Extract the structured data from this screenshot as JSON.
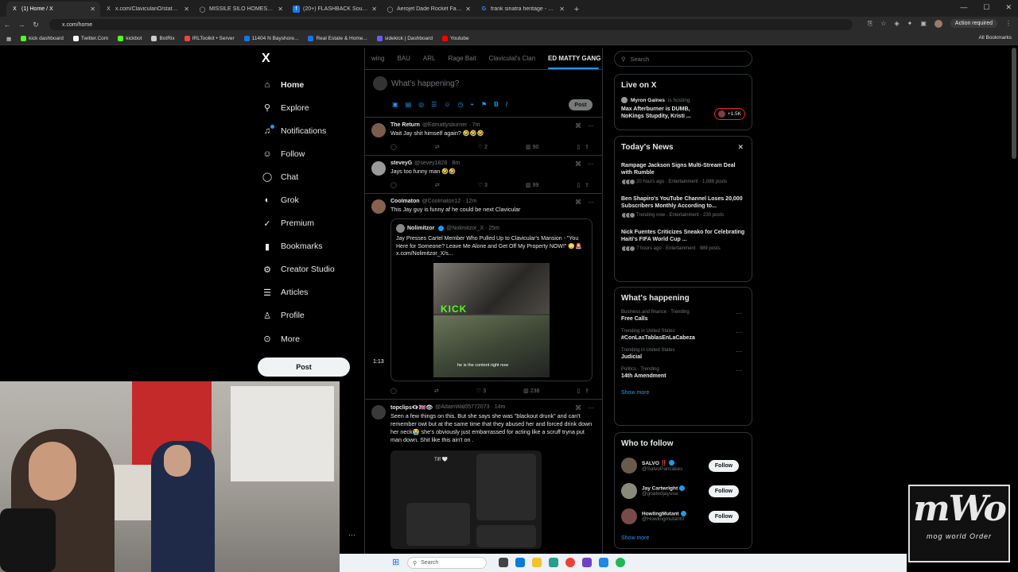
{
  "browser": {
    "tabs": [
      {
        "title": "(1) Home / X",
        "color": "#ffffff",
        "glyph": "X"
      },
      {
        "title": "x.com/ClaviculanO/status/2039...",
        "color": "#ffffff",
        "glyph": "X"
      },
      {
        "title": "MISSILE SILO HOMESTEAD - G...",
        "color": "#aaaaaa",
        "glyph": "◯"
      },
      {
        "title": "(20+) FLASHBACK South Florid...",
        "color": "#1877f2",
        "glyph": "f"
      },
      {
        "title": "Aerojet Dade Rocket Facility | ...",
        "color": "#aaaaaa",
        "glyph": "◯"
      },
      {
        "title": "frank sinatra heritage - Google...",
        "color": "#4285f4",
        "glyph": "G"
      }
    ],
    "new_tab": "+",
    "url": "x.com/home",
    "action_required": "Action required",
    "bookmarks": [
      {
        "label": "kick dashboard",
        "color": "#53fc18"
      },
      {
        "label": "Twitter.Com",
        "color": "#ffffff"
      },
      {
        "label": "kickbot",
        "color": "#53fc18"
      },
      {
        "label": "BotRix",
        "color": "#cccccc"
      },
      {
        "label": "IRLToolkit • Server",
        "color": "#e44"
      },
      {
        "label": "11404 N Bayshore...",
        "color": "#1a73e8"
      },
      {
        "label": "Real Estate & Home...",
        "color": "#1a73e8"
      },
      {
        "label": "sidekick | Dashboard",
        "color": "#6b5bff"
      },
      {
        "label": "Youtube",
        "color": "#ff0000"
      }
    ],
    "all_bookmarks": "All Bookmarks"
  },
  "nav": {
    "logo": "X",
    "items": [
      {
        "label": "Home",
        "icon": "⌂",
        "bold": true
      },
      {
        "label": "Explore",
        "icon": "⚲"
      },
      {
        "label": "Notifications",
        "icon": "♫"
      },
      {
        "label": "Follow",
        "icon": "☺"
      },
      {
        "label": "Chat",
        "icon": "◯"
      },
      {
        "label": "Grok",
        "icon": "◐"
      },
      {
        "label": "Premium",
        "icon": "✓"
      },
      {
        "label": "Bookmarks",
        "icon": "▮"
      },
      {
        "label": "Creator Studio",
        "icon": "⚙"
      },
      {
        "label": "Articles",
        "icon": "☰"
      },
      {
        "label": "Profile",
        "icon": "♙"
      },
      {
        "label": "More",
        "icon": "⊙"
      }
    ],
    "post_button": "Post"
  },
  "timeline": {
    "tabs": [
      "wing",
      "BAU",
      "ARL",
      "Rage Bait",
      "Claviculal's Clan",
      "ED MATTY GANG"
    ],
    "composer_placeholder": "What's happening?",
    "composer_post": "Post",
    "tweets": [
      {
        "name": "The Return",
        "meta": "@Edmattysburner · 7m",
        "text": "Wait Jay shit himself again? 🤣🤣🤣",
        "replies": "",
        "reposts": "",
        "likes": "2",
        "views": "90",
        "avatar": "#7a5d4a"
      },
      {
        "name": "steveyG",
        "meta": "@sevey1828 · 8m",
        "text": "Jays too funny man 🤣🤣",
        "replies": "",
        "reposts": "",
        "likes": "3",
        "views": "99",
        "avatar": "#9a9a9a"
      },
      {
        "name": "Coolmaton",
        "meta": "@Coolmaton12 · 12m",
        "text": "This Jay guy is funny af he could be next Clavicular",
        "quote_name": "Nolimitzor",
        "quote_meta": "@Nolimitzor_X · 25m",
        "quote_text": "Jay Presses Cartel Member Who Pulled Up to Clavicular's Mansion - \"You Here for Someone? Leave Me Alone and Get Off My Property NOW!\" 😳🚨 x.com/Nolimitzor_X/s...",
        "media_kick": "KICK",
        "media_caption": "he is the content right now",
        "duration": "1:13",
        "replies": "",
        "reposts": "",
        "likes": "3",
        "views": "238",
        "avatar": "#8a6050"
      },
      {
        "name": "topclips👁‍🗨🇬🇧👁",
        "meta": "@AdamWal05772073 · 14m",
        "text": "Seen a few things on this. But she says she was \"blackout drunk\" and can't remember owt but at the same time that they abused her and forced drink down her neck😭 she's obviously just embarrassed for acting like a scruff tryna put man down. Shit like this ain't on .",
        "shot_name": "Tiff 🤍",
        "avatar": "#3a3a3a"
      }
    ]
  },
  "right": {
    "search_placeholder": "Search",
    "live": {
      "title": "Live on X",
      "host": "Myron Gaines",
      "host_suffix": "is hosting",
      "space_title": "Max Afterburner is DUMB, NoKings Stupdity, Kristi ...",
      "count": "+1.5K"
    },
    "news": {
      "title": "Today's News",
      "close": "✕",
      "items": [
        {
          "title": "Rampage Jackson Signs Multi-Stream Deal with Rumble",
          "meta": "20 hours ago · Entertainment · 1,088 posts"
        },
        {
          "title": "Ben Shapiro's YouTube Channel Loses 20,000 Subscribers Monthly According to...",
          "meta": "Trending now · Entertainment · 230 posts"
        },
        {
          "title": "Nick Fuentes Criticizes Sneako for Celebrating Haiti's FIFA World Cup ...",
          "meta": "7 hours ago · Entertainment · 989 posts"
        }
      ]
    },
    "happening": {
      "title": "What's happening",
      "items": [
        {
          "category": "Business and finance · Trending",
          "name": "Free Calls"
        },
        {
          "category": "Trending in United States",
          "name": "#ConLasTablasEnLaCabeza"
        },
        {
          "category": "Trending in United States",
          "name": "Judicial"
        },
        {
          "category": "Politics · Trending",
          "name": "14th Amendment"
        }
      ],
      "show_more": "Show more"
    },
    "who": {
      "title": "Who to follow",
      "items": [
        {
          "name": "SALVO ‼️",
          "handle": "@SalvoPancakes",
          "button": "Follow"
        },
        {
          "name": "Jay Cartwright",
          "handle": "@goatedjayusa",
          "button": "Follow"
        },
        {
          "name": "HowlingMutant",
          "handle": "@Howlingmutant0",
          "button": "Follow"
        }
      ],
      "show_more": "Show more"
    }
  },
  "taskbar": {
    "search": "Search"
  },
  "watermark": {
    "big": "mWo",
    "small": "mog world Order"
  }
}
